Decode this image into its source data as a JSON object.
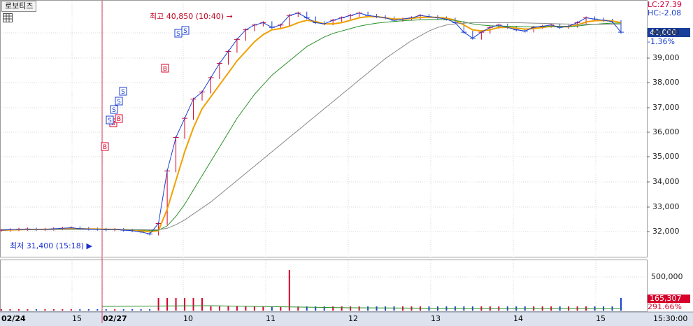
{
  "header": {
    "title": "로보티즈",
    "grid_icon": "table-grid-icon"
  },
  "indicators": {
    "lc": "LC:27.39",
    "hc": "HC:-2.08"
  },
  "current": {
    "price": "40,000",
    "change_pct": "-1.36%"
  },
  "volume": {
    "current": "165,307",
    "pct": "291.66%",
    "axis_tick": "500,000"
  },
  "annotations": {
    "high": "최고 40,850 (10:40)",
    "low": "최저 31,400 (15:18)"
  },
  "price_axis": [
    "40,000",
    "39,000",
    "38,000",
    "37,000",
    "36,000",
    "35,000",
    "34,000",
    "33,000",
    "32,000"
  ],
  "x_axis": {
    "labels": [
      {
        "text": "02/24",
        "bold": true
      },
      {
        "text": "15",
        "bold": false
      },
      {
        "text": "02/27",
        "bold": true
      },
      {
        "text": "10",
        "bold": false
      },
      {
        "text": "11",
        "bold": false
      },
      {
        "text": "12",
        "bold": false
      },
      {
        "text": "13",
        "bold": false
      },
      {
        "text": "14",
        "bold": false
      },
      {
        "text": "15",
        "bold": false
      }
    ],
    "time": "15:30:00"
  },
  "colors": {
    "up": "#d6002a",
    "down": "#1a3fd0",
    "ma_short": "#f0a000",
    "ma_mid": "#2a8f2a",
    "ma_long": "#888888",
    "grid": "#d8d8d8",
    "marker_red": "#d6002a",
    "marker_blue": "#1a3fd0"
  },
  "chart_data": {
    "type": "line",
    "ylim": [
      31400,
      40850
    ],
    "series": [
      {
        "values": [
          31720,
          31740,
          31760,
          31770,
          31750,
          31760,
          31780,
          31800,
          31820,
          31790,
          31770,
          31760,
          31740,
          31750,
          31720,
          31700,
          31650,
          31560,
          32000,
          34200,
          35600,
          36400,
          37200,
          37500,
          38100,
          38700,
          39200,
          39700,
          40100,
          40300,
          40400,
          40200,
          40300,
          40700,
          40800,
          40600,
          40400,
          40350,
          40500,
          40600,
          40700,
          40800,
          40700,
          40650,
          40600,
          40500,
          40550,
          40600,
          40700,
          40650,
          40600,
          40550,
          40400,
          40000,
          39750,
          40000,
          40200,
          40300,
          40200,
          40100,
          40050,
          40200,
          40250,
          40300,
          40200,
          40250,
          40400,
          40600,
          40550,
          40500,
          40450,
          40000
        ]
      },
      {
        "values": [
          31720,
          31730,
          31740,
          31750,
          31750,
          31755,
          31760,
          31770,
          31780,
          31780,
          31775,
          31770,
          31760,
          31755,
          31745,
          31730,
          31700,
          31650,
          31700,
          32600,
          33800,
          35000,
          36000,
          36800,
          37300,
          37800,
          38300,
          38800,
          39200,
          39600,
          39900,
          40100,
          40150,
          40250,
          40400,
          40500,
          40450,
          40350,
          40350,
          40400,
          40500,
          40600,
          40650,
          40650,
          40600,
          40550,
          40550,
          40580,
          40620,
          40630,
          40620,
          40590,
          40500,
          40300,
          40100,
          40050,
          40100,
          40200,
          40200,
          40170,
          40130,
          40150,
          40200,
          40250,
          40230,
          40230,
          40300,
          40430,
          40480,
          40490,
          40470,
          40400
        ]
      },
      {
        "values": [
          31750,
          31750,
          31750,
          31750,
          31750,
          31750,
          31755,
          31760,
          31760,
          31760,
          31760,
          31760,
          31755,
          31750,
          31745,
          31740,
          31730,
          31710,
          31720,
          31900,
          32300,
          32800,
          33400,
          34000,
          34600,
          35200,
          35800,
          36400,
          36900,
          37400,
          37800,
          38200,
          38500,
          38800,
          39100,
          39400,
          39600,
          39800,
          39950,
          40050,
          40150,
          40250,
          40320,
          40380,
          40420,
          40450,
          40480,
          40500,
          40520,
          40530,
          40530,
          40520,
          40490,
          40430,
          40350,
          40300,
          40270,
          40260,
          40250,
          40240,
          40230,
          40230,
          40230,
          40240,
          40240,
          40240,
          40260,
          40300,
          40330,
          40360,
          40380,
          40380
        ]
      },
      {
        "values": [
          31750,
          31750,
          31750,
          31750,
          31750,
          31750,
          31750,
          31750,
          31750,
          31750,
          31750,
          31750,
          31750,
          31750,
          31748,
          31745,
          31742,
          31738,
          31740,
          31800,
          31950,
          32150,
          32400,
          32650,
          32900,
          33200,
          33500,
          33800,
          34100,
          34400,
          34700,
          35000,
          35300,
          35600,
          35900,
          36200,
          36500,
          36800,
          37100,
          37400,
          37700,
          38000,
          38300,
          38600,
          38900,
          39150,
          39400,
          39650,
          39850,
          40050,
          40200,
          40300,
          40350,
          40380,
          40400,
          40400,
          40400,
          40400,
          40400,
          40400,
          40390,
          40380,
          40370,
          40360,
          40350,
          40340,
          40330,
          40330,
          40330,
          40330,
          40330,
          40330
        ]
      }
    ]
  }
}
